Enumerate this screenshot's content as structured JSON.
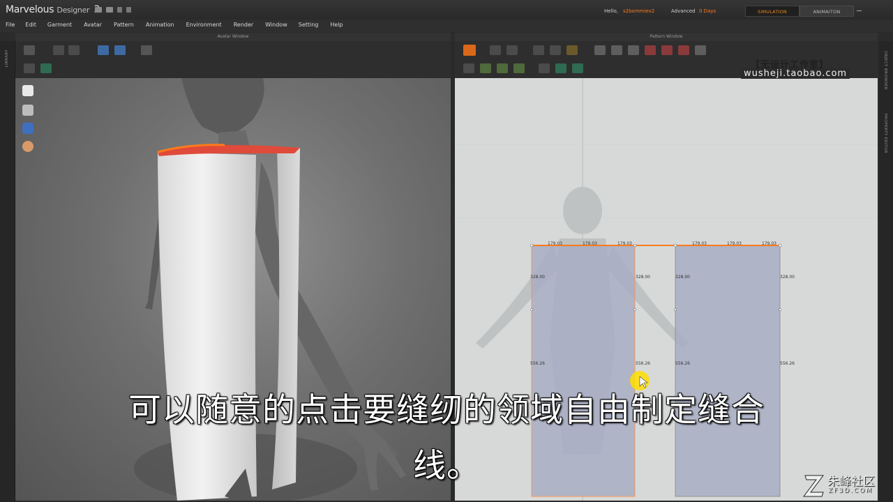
{
  "app": {
    "name": "Marvelous",
    "name_sub": "Designer",
    "version": "3"
  },
  "header": {
    "hello_label": "Hello,",
    "username": "s2bommiex2",
    "license_label": "Advanced",
    "days_left": "0 Days",
    "mode_simulation": "SIMULATION",
    "mode_animation": "ANIMAITON"
  },
  "menu": [
    "File",
    "Edit",
    "Garment",
    "Avatar",
    "Pattern",
    "Animation",
    "Environment",
    "Render",
    "Window",
    "Setting",
    "Help"
  ],
  "windows": {
    "avatar_title": "Avatar Window",
    "pattern_title": "Pattern Window"
  },
  "side_labels": {
    "library": "LIBRARY",
    "object_browser": "OBJECT BROWSER",
    "property_editor": "PROPERTY EDITOR"
  },
  "watermark": {
    "line1": "【无设计工作室】",
    "line2": "wusheji.taobao.com"
  },
  "pattern_measurements": {
    "top_left_a": "179.03",
    "top_left_b": "179.03",
    "top_left_c": "179.03",
    "top_right_a": "179.03",
    "top_right_b": "179.03",
    "top_right_c": "179.03",
    "left_panel_left_1": "328.00",
    "left_panel_right_1": "328.00",
    "right_panel_left_1": "328.00",
    "right_panel_right_1": "328.00",
    "left_panel_left_2": "556.26",
    "left_panel_right_2": "556.26",
    "right_panel_left_2": "556.26",
    "right_panel_right_2": "556.26"
  },
  "subtitle": {
    "line1": "可以随意的点击要缝纫的领域自由制定缝合",
    "line2": "线。"
  },
  "brand": {
    "name": "朱峰社区",
    "domain": "ZF3D.COM"
  },
  "colors": {
    "accent_orange": "#ff7a1a",
    "pattern_fill": "#a9aec5",
    "pattern_bg": "#d7d9d9"
  }
}
